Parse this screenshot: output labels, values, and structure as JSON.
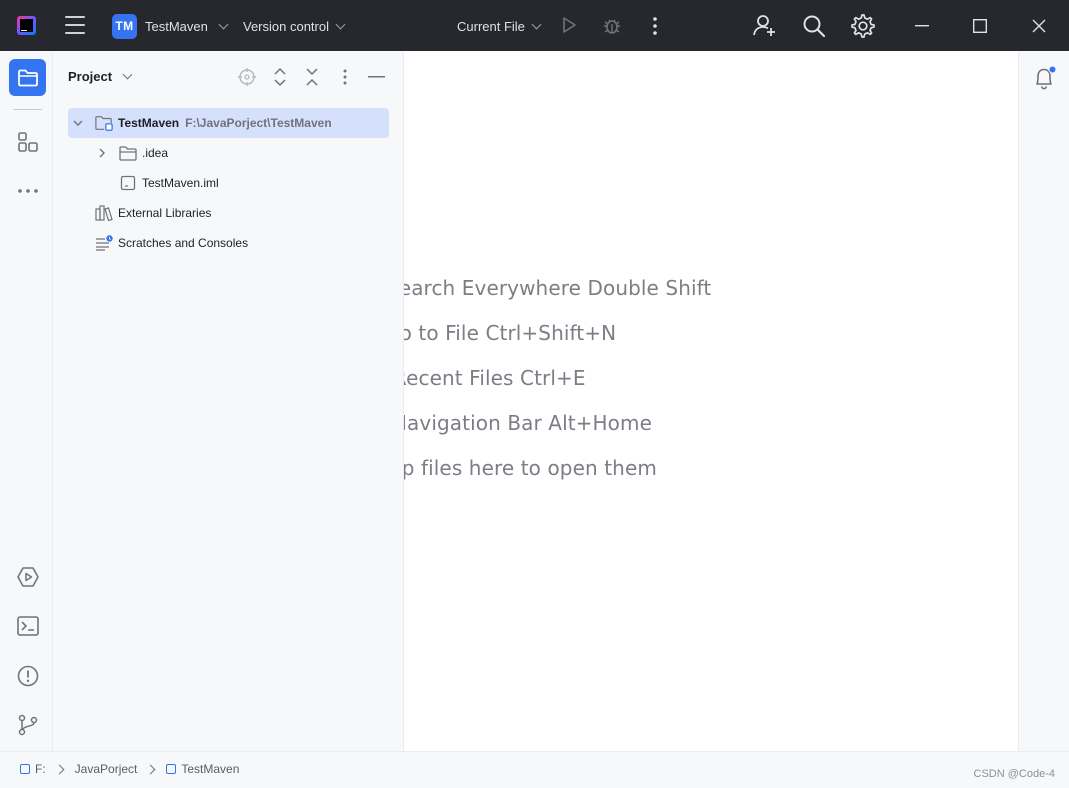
{
  "titlebar": {
    "project_badge": "TM",
    "project_name": "TestMaven",
    "vcs_label": "Version control",
    "run_config": "Current File",
    "icons": [
      "main-menu-icon",
      "run-icon",
      "debug-icon",
      "more-vertical-icon",
      "add-user-icon",
      "search-icon",
      "settings-gear-icon",
      "minimize-icon",
      "maximize-icon",
      "close-icon"
    ]
  },
  "left_strip": {
    "items": [
      "project-folder-icon",
      "structure-icon",
      "more-tools-icon",
      "run-services-icon",
      "terminal-icon",
      "problems-icon",
      "git-branch-icon"
    ]
  },
  "project_panel": {
    "title": "Project",
    "tree": [
      {
        "label": "TestMaven",
        "path": "F:\\JavaPorject\\TestMaven",
        "expanded": true,
        "selected": true
      },
      {
        "label": ".idea",
        "expanded": false
      },
      {
        "label": "TestMaven.iml"
      },
      {
        "label": "External Libraries"
      },
      {
        "label": "Scratches and Consoles"
      }
    ]
  },
  "editor": {
    "hints": [
      "Search Everywhere Double Shift",
      "Go to File Ctrl+Shift+N",
      "Recent Files Ctrl+E",
      "Navigation Bar Alt+Home",
      "Drop files here to open them"
    ]
  },
  "status_bar": {
    "breadcrumbs": [
      "F:",
      "JavaPorject",
      "TestMaven"
    ],
    "watermark": "CSDN @Code-4"
  },
  "colors": {
    "accent": "#3574f0",
    "titlebar_bg": "#27282e",
    "selection": "#d5e1fc",
    "hint_text": "#7b7e85"
  }
}
